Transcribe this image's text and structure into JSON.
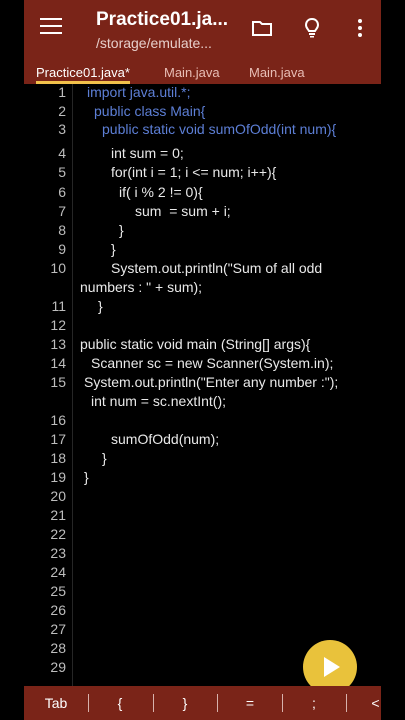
{
  "appbar": {
    "title": "Practice01.ja...",
    "subtitle": "/storage/emulate..."
  },
  "tabs": [
    {
      "label": "Practice01.java*"
    },
    {
      "label": "Main.java"
    },
    {
      "label": "Main.java"
    }
  ],
  "lines": [
    {
      "n": "1",
      "text": "import java.util.*;"
    },
    {
      "n": "2",
      "text": "public class Main{"
    },
    {
      "n": "3",
      "text": "public static void sumOfOdd(int num){"
    },
    {
      "n": "4",
      "text": "int sum = 0;"
    },
    {
      "n": "5",
      "text": "for(int i = 1; i <= num; i++){"
    },
    {
      "n": "6",
      "text": "if( i % 2 != 0){"
    },
    {
      "n": "7",
      "text": "sum  = sum + i;"
    },
    {
      "n": "8",
      "text": "}"
    },
    {
      "n": "9",
      "text": "}"
    },
    {
      "n": "10",
      "text": "System.out.println(\"Sum of all odd"
    },
    {
      "n": "",
      "text": "numbers : \" + sum);"
    },
    {
      "n": "11",
      "text": "}"
    },
    {
      "n": "12",
      "text": ""
    },
    {
      "n": "13",
      "text": "public static void main (String[] args){"
    },
    {
      "n": "14",
      "text": "Scanner sc = new Scanner(System.in);"
    },
    {
      "n": "15",
      "text": "System.out.println(\"Enter any number :\");"
    },
    {
      "n": "",
      "text": "int num = sc.nextInt();"
    },
    {
      "n": "16",
      "text": ""
    },
    {
      "n": "17",
      "text": "sumOfOdd(num);"
    },
    {
      "n": "18",
      "text": "}"
    },
    {
      "n": "19",
      "text": "}"
    },
    {
      "n": "20",
      "text": ""
    },
    {
      "n": "21",
      "text": ""
    },
    {
      "n": "22",
      "text": ""
    },
    {
      "n": "23",
      "text": ""
    },
    {
      "n": "24",
      "text": ""
    },
    {
      "n": "25",
      "text": ""
    },
    {
      "n": "26",
      "text": ""
    },
    {
      "n": "27",
      "text": ""
    },
    {
      "n": "28",
      "text": ""
    },
    {
      "n": "29",
      "text": ""
    }
  ],
  "bottombar": {
    "keys": [
      "Tab",
      "{",
      "}",
      "=",
      ";",
      "<"
    ]
  },
  "colors": {
    "appbar": "#7a2418",
    "fab": "#e9c23b"
  },
  "icons": {
    "menu": "hamburger-menu-icon",
    "folder": "folder-icon",
    "bulb": "lightbulb-icon",
    "more": "more-vert-icon",
    "run": "play-icon"
  }
}
